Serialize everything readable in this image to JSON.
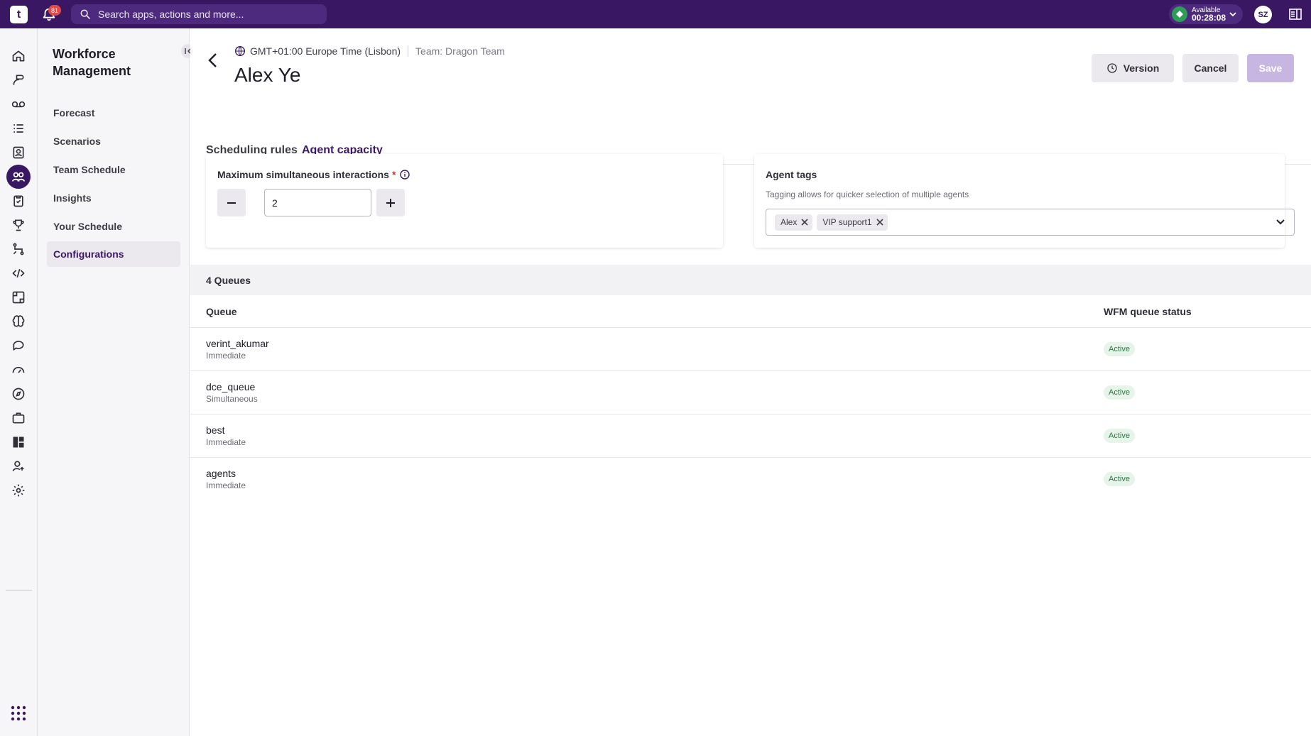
{
  "topbar": {
    "logo_text": "t",
    "notification_count": "81",
    "search_placeholder": "Search apps, actions and more...",
    "status_label": "Available",
    "status_timer": "00:28:08",
    "user_initials": "SZ"
  },
  "rail": {
    "icons": [
      "home-icon",
      "contact-icon",
      "voicemail-icon",
      "list-icon",
      "contacts-book-icon",
      "workforce-icon",
      "clipboard-icon",
      "trophy-icon",
      "routing-icon",
      "code-icon",
      "layout-icon",
      "brain-icon",
      "chat-icon",
      "gauge-icon",
      "compass-icon",
      "briefcase-icon",
      "dashboard-icon",
      "user-settings-icon",
      "gear-icon"
    ],
    "active": "workforce-icon"
  },
  "nav": {
    "title": "Workforce Management",
    "items": [
      {
        "label": "Forecast"
      },
      {
        "label": "Scenarios"
      },
      {
        "label": "Team Schedule"
      },
      {
        "label": "Insights"
      },
      {
        "label": "Your Schedule"
      },
      {
        "label": "Configurations"
      }
    ],
    "active_index": 5
  },
  "header": {
    "timezone": "GMT+01:00 Europe Time (Lisbon)",
    "team": "Team: Dragon Team",
    "title": "Alex Ye",
    "version_label": "Version",
    "cancel_label": "Cancel",
    "save_label": "Save"
  },
  "tabs": [
    {
      "label": "Scheduling rules"
    },
    {
      "label": "Agent capacity"
    }
  ],
  "active_tab": 1,
  "capacity": {
    "label": "Maximum simultaneous interactions",
    "required_mark": "*",
    "value": "2"
  },
  "agent_tags": {
    "label": "Agent tags",
    "helper": "Tagging allows for quicker selection of multiple agents",
    "tags": [
      "Alex",
      "VIP support1"
    ]
  },
  "queues": {
    "count_label": "4 Queues",
    "columns": [
      "Queue",
      "WFM queue status"
    ],
    "rows": [
      {
        "name": "verint_akumar",
        "type": "Immediate",
        "status": "Active"
      },
      {
        "name": "dce_queue",
        "type": "Simultaneous",
        "status": "Active"
      },
      {
        "name": "best",
        "type": "Immediate",
        "status": "Active"
      },
      {
        "name": "agents",
        "type": "Immediate",
        "status": "Active"
      }
    ]
  },
  "colors": {
    "brand": "#3a1763",
    "status_green": "#2e9d57",
    "badge_bg": "#e6f4ea",
    "save_disabled": "#c8b6e2"
  }
}
